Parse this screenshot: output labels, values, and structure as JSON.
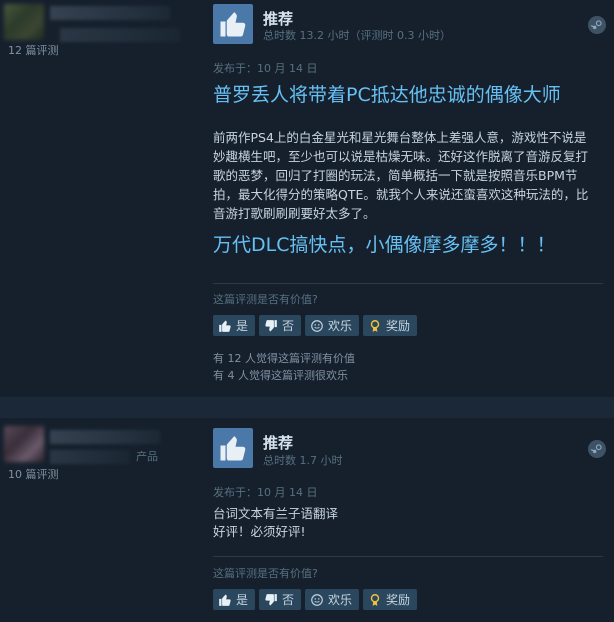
{
  "reviews": [
    {
      "review_count": "12 篇评测",
      "recommendation": "推荐",
      "hours": "总时数 13.2 小时（评测时 0.3 小时）",
      "posted": "发布于：10 月 14 日",
      "headline": "普罗丢人将带着PC抵达他忠诚的偶像大师",
      "body": "前两作PS4上的白金星光和星光舞台整体上差强人意，游戏性不说是妙趣横生吧，至少也可以说是枯燥无味。还好这作脱离了音游反复打歌的恶梦，回归了打圈的玩法，简单概括一下就是按照音乐BPM节拍，最大化得分的策略QTE。就我个人来说还蛮喜欢这种玩法的，比音游打歌刷刷刷要好太多了。",
      "closing": "万代DLC搞快点，小偶像摩多摩多！！！",
      "helpful_question": "这篇评测是否有价值?",
      "buttons": {
        "yes": "是",
        "no": "否",
        "funny": "欢乐",
        "award": "奖励"
      },
      "stats_helpful": "有 12 人觉得这篇评测有价值",
      "stats_funny": "有 4 人觉得这篇评测很欢乐"
    },
    {
      "review_count": "10 篇评测",
      "name_fragment": "产品",
      "recommendation": "推荐",
      "hours": "总时数 1.7 小时",
      "posted": "发布于：10 月 14 日",
      "line1": "台词文本有兰子语翻译",
      "line2": "好评！必须好评!",
      "helpful_question": "这篇评测是否有价值?",
      "buttons": {
        "yes": "是",
        "no": "否",
        "funny": "欢乐",
        "award": "奖励"
      }
    }
  ],
  "colors": {
    "accent": "#66c0f4",
    "thumb_bg": "#4a78a8",
    "button_bg": "#2a475e"
  }
}
